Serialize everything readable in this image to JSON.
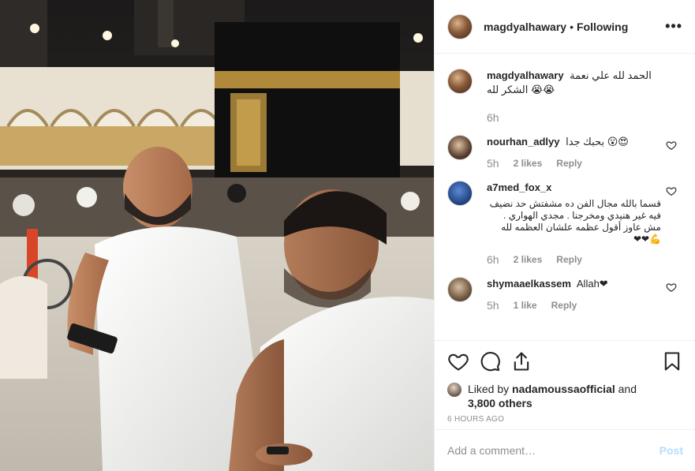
{
  "post": {
    "author": "magdyalhawary",
    "separator": "•",
    "follow_status": "Following",
    "more_icon": "more-horizontal-icon"
  },
  "comments": [
    {
      "user": "magdyalhawary",
      "text": "الحمد لله علي نعمة الشكر لله 😭😭",
      "time": "6h",
      "likes": "",
      "reply": ""
    },
    {
      "user": "nourhan_adlyy",
      "text": "بحبك جدا 😮😍",
      "time": "5h",
      "likes": "2 likes",
      "reply": "Reply"
    },
    {
      "user": "a7med_fox_x",
      "text": "قسما بالله مجال الفن ده مشفتش حد نضيف فيه غير هنيدي ومخرجنا . مجدي الهواري . مش عاوز أقول عظمه علشان العظمه لله 💪❤❤",
      "time": "6h",
      "likes": "2 likes",
      "reply": "Reply"
    },
    {
      "user": "shymaaelkassem",
      "text": "Allah❤",
      "time": "5h",
      "likes": "1 like",
      "reply": "Reply"
    }
  ],
  "actions": {
    "like_icon": "heart-icon",
    "comment_icon": "comment-icon",
    "share_icon": "share-icon",
    "save_icon": "bookmark-icon"
  },
  "likes": {
    "prefix": "Liked by",
    "user": "nadamoussaofficial",
    "and": "and",
    "others": "3,800 others"
  },
  "timestamp": "6 HOURS AGO",
  "add_comment": {
    "placeholder": "Add a comment…",
    "post_label": "Post"
  },
  "colors": {
    "text": "#262626",
    "muted": "#8e8e8e",
    "post_disabled": "#b2dffc",
    "border": "#efefef"
  }
}
